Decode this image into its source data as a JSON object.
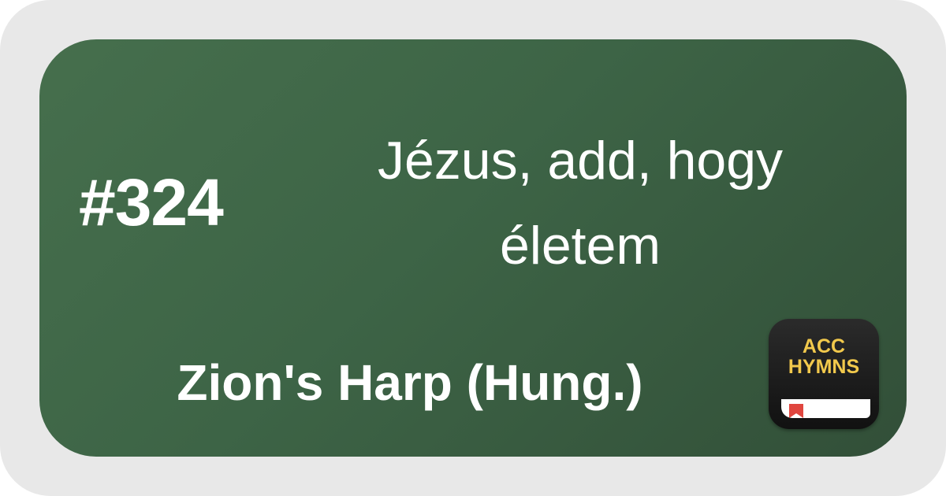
{
  "card": {
    "number": "#324",
    "title": "Jézus, add, hogy életem",
    "hymnal": "Zion's Harp (Hung.)"
  },
  "logo": {
    "line1": "ACC",
    "line2": "HYMNS",
    "icon": "hymnal-book-icon",
    "colors": {
      "text": "#f2c94c",
      "ribbon": "#e0463f",
      "background": "#1a1a1a"
    }
  },
  "colors": {
    "card_background": "#3d6446",
    "frame": "#e8e8e8",
    "text": "#ffffff"
  }
}
